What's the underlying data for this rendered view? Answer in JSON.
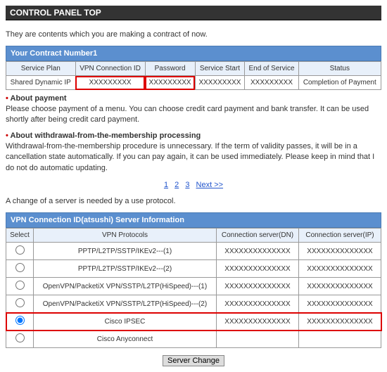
{
  "title": "CONTROL PANEL TOP",
  "intro": "They are contents which you are making a contract of now.",
  "contract": {
    "header": "Your Contract Number1",
    "cols": [
      "Service Plan",
      "VPN Connection ID",
      "Password",
      "Service Start",
      "End of Service",
      "Status"
    ],
    "row": {
      "plan": "Shared Dynamic IP",
      "vpn": "XXXXXXXXX",
      "pw": "XXXXXXXXX",
      "start": "XXXXXXXXX",
      "end": "XXXXXXXXX",
      "status": "Completion of Payment"
    }
  },
  "payment": {
    "title": "About payment",
    "body": "Please choose payment of a menu. You can choose credit card payment and bank transfer. It can be used shortly after being credit card payment."
  },
  "withdrawal": {
    "title": "About withdrawal-from-the-membership processing",
    "body": "Withdrawal-from-the-membership procedure is unnecessary. If the term of validity passes, it will be in a cancellation state automatically. If you can pay again, it can be used immediately. Please keep in mind that I do not do automatic updating."
  },
  "pagination": {
    "p1": "1",
    "p2": "2",
    "p3": "3",
    "next": "Next >>"
  },
  "proto_note": "A change of a server is needed by a use protocol.",
  "server": {
    "header": "VPN Connection ID(atsushi) Server Information",
    "cols": [
      "Select",
      "VPN Protocols",
      "Connection server(DN)",
      "Connection server(IP)"
    ],
    "rows": [
      {
        "proto": "PPTP/L2TP/SSTP/IKEv2---(1)",
        "dn": "XXXXXXXXXXXXXX",
        "ip": "XXXXXXXXXXXXXX",
        "sel": false
      },
      {
        "proto": "PPTP/L2TP/SSTP/IKEv2---(2)",
        "dn": "XXXXXXXXXXXXXX",
        "ip": "XXXXXXXXXXXXXX",
        "sel": false
      },
      {
        "proto": "OpenVPN/PacketiX VPN/SSTP/L2TP(HiSpeed)---(1)",
        "dn": "XXXXXXXXXXXXXX",
        "ip": "XXXXXXXXXXXXXX",
        "sel": false
      },
      {
        "proto": "OpenVPN/PacketiX VPN/SSTP/L2TP(HiSpeed)---(2)",
        "dn": "XXXXXXXXXXXXXX",
        "ip": "XXXXXXXXXXXXXX",
        "sel": false
      },
      {
        "proto": "Cisco IPSEC",
        "dn": "XXXXXXXXXXXXXX",
        "ip": "XXXXXXXXXXXXXX",
        "sel": true
      },
      {
        "proto": "Cisco Anyconnect",
        "dn": "",
        "ip": "",
        "sel": false
      }
    ]
  },
  "button": "Server Change"
}
